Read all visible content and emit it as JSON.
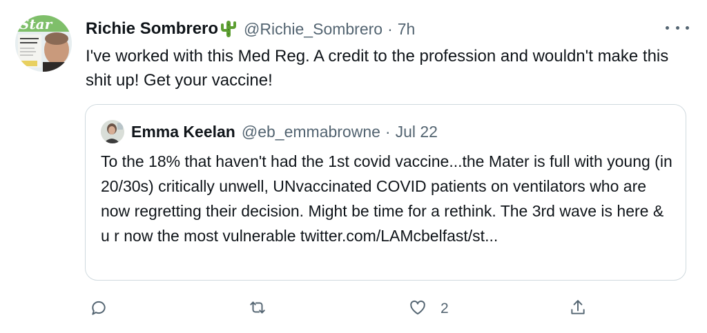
{
  "tweet": {
    "author_name": "Richie Sombrero",
    "author_emoji": "cactus-icon",
    "handle": "@Richie_Sombrero",
    "separator": "·",
    "time": "7h",
    "text": "I've worked with this Med Reg. A credit to the profession and wouldn't make this shit up! Get your vaccine!"
  },
  "quoted": {
    "author_name": "Emma Keelan",
    "handle": "@eb_emmabrowne",
    "separator": "·",
    "date": "Jul 22",
    "text": "To the 18% that haven't had the 1st covid vaccine...the Mater is full with young (in 20/30s) critically unwell, UNvaccinated COVID patients on ventilators who are now regretting their decision. Might be time for a rethink. The 3rd wave is here & u r now the most vulnerable twitter.com/LAMcbelfast/st..."
  },
  "actions": {
    "reply_count": "",
    "retweet_count": "",
    "like_count": "2",
    "share_count": ""
  },
  "colors": {
    "text_primary": "#0f1419",
    "text_secondary": "#536471",
    "border": "#cfd9de",
    "cactus_green": "#5c9e31"
  }
}
